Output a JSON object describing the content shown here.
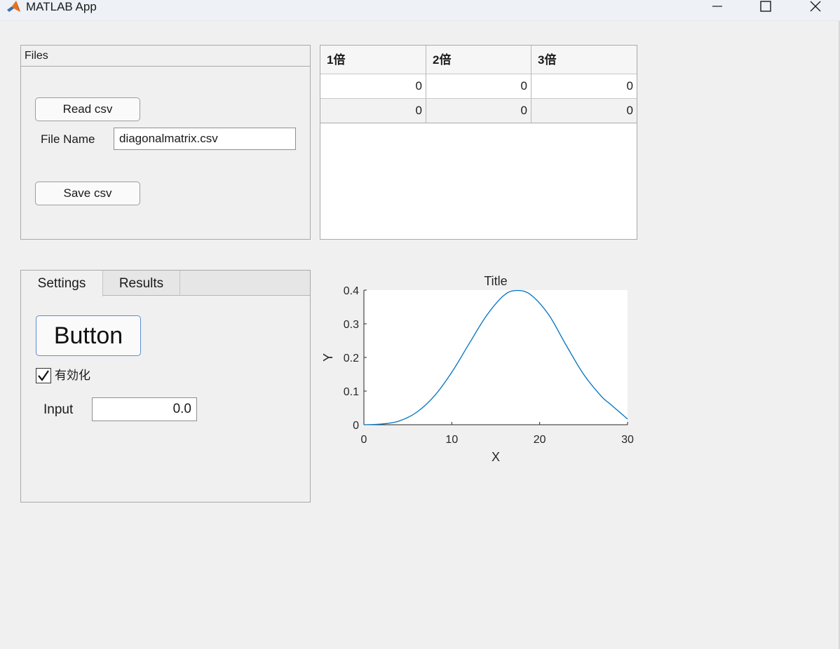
{
  "window": {
    "title": "MATLAB App"
  },
  "files_panel": {
    "title": "Files",
    "read_label": "Read csv",
    "file_name_label": "File Name",
    "file_name_value": "diagonalmatrix.csv",
    "save_label": "Save csv"
  },
  "table": {
    "columns": [
      "1倍",
      "2倍",
      "3倍"
    ],
    "rows": [
      [
        "0",
        "0",
        "0"
      ],
      [
        "0",
        "0",
        "0"
      ]
    ]
  },
  "tabs": {
    "items": [
      {
        "label": "Settings",
        "active": true
      },
      {
        "label": "Results",
        "active": false
      }
    ],
    "settings": {
      "button_label": "Button",
      "checkbox_label": "有効化",
      "checkbox_checked": true,
      "input_label": "Input",
      "input_value": "0.0"
    }
  },
  "colors": {
    "line": "#0072bd",
    "focus_border": "#5b8fd0"
  },
  "chart_data": {
    "type": "line",
    "title": "Title",
    "xlabel": "X",
    "ylabel": "Y",
    "xlim": [
      0,
      30
    ],
    "ylim": [
      0,
      0.4
    ],
    "xticks": [
      0,
      10,
      20,
      30
    ],
    "yticks": [
      0,
      0.1,
      0.2,
      0.3,
      0.4
    ],
    "xtick_labels": [
      "0",
      "10",
      "20",
      "30"
    ],
    "ytick_labels": [
      "0",
      "0.1",
      "0.2",
      "0.3",
      "0.4"
    ],
    "grid": false,
    "series": [
      {
        "x": [
          0,
          2,
          4,
          6,
          8,
          10,
          12,
          14,
          16,
          17.5,
          19,
          21,
          23,
          25,
          27,
          28,
          30
        ],
        "y": [
          0.0,
          0.002,
          0.011,
          0.037,
          0.085,
          0.156,
          0.242,
          0.326,
          0.386,
          0.399,
          0.386,
          0.328,
          0.237,
          0.15,
          0.085,
          0.062,
          0.017
        ]
      }
    ]
  }
}
